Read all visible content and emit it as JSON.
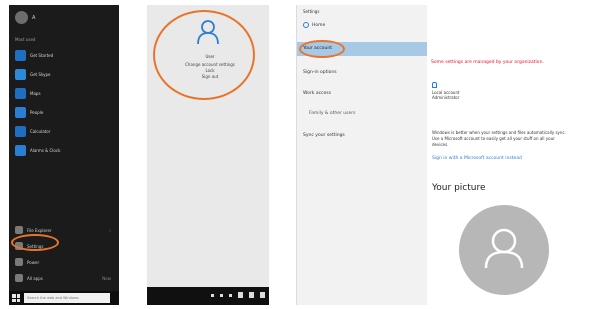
{
  "start_menu": {
    "user_name": "A",
    "section_label": "Most used",
    "apps": [
      {
        "label": "Get Started",
        "color": "#1e6fc2"
      },
      {
        "label": "Get Skype",
        "color": "#2c8ad8"
      },
      {
        "label": "Maps",
        "color": "#1e6fc2"
      },
      {
        "label": "People",
        "color": "#2a7fd4"
      },
      {
        "label": "Calculator",
        "color": "#1e6fc2"
      },
      {
        "label": "Alarms & Clock",
        "color": "#2a7fd4"
      }
    ],
    "bottom": {
      "explorer": "File Explorer",
      "settings": "Settings",
      "power": "Power",
      "all_apps": "All apps",
      "new_badge": "New"
    },
    "search_placeholder": "Search the web and Windows"
  },
  "account_flyout": {
    "name": "User",
    "lines": [
      "Change account settings",
      "Lock",
      "Sign out"
    ]
  },
  "settings": {
    "window_title": "Settings",
    "home_label": "Home",
    "nav": [
      {
        "label": "Your account",
        "active": true
      },
      {
        "label": "Sign-in options",
        "active": false
      },
      {
        "label": "Work access",
        "active": false
      },
      {
        "label": "Family & other users",
        "active": false,
        "sub": true
      },
      {
        "label": "Sync your settings",
        "active": false
      }
    ],
    "warning": "Some settings are managed by your organization.",
    "account_name": "Local account",
    "account_type": "Administrator",
    "desc_lines": [
      "Windows is better when your settings and files automatically sync.",
      "Use a Microsoft account to easily get all your stuff on all your",
      "devices."
    ],
    "link": "Sign in with a Microsoft account instead",
    "pic_heading": "Your picture",
    "accent": "#2a7fd4",
    "warning_color": "#e81123"
  }
}
